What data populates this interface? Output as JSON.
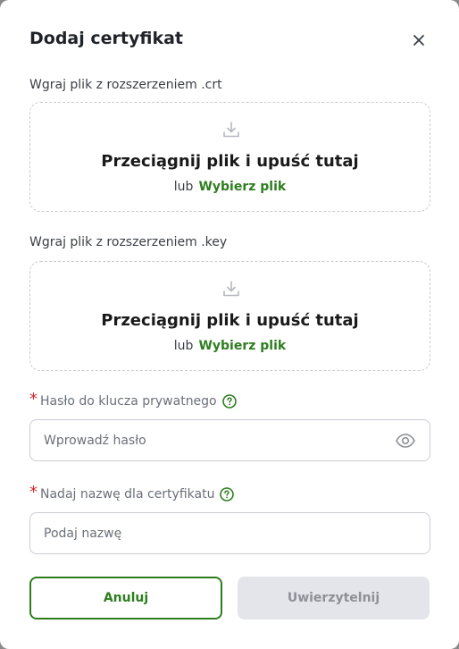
{
  "dialog": {
    "title": "Dodaj certyfikat"
  },
  "crt_upload": {
    "label": "Wgraj plik z rozszerzeniem .crt",
    "drop_text": "Przeciągnij plik i upuść tutaj",
    "or_text": "lub",
    "pick_text": "Wybierz plik"
  },
  "key_upload": {
    "label": "Wgraj plik z rozszerzeniem .key",
    "drop_text": "Przeciągnij plik i upuść tutaj",
    "or_text": "lub",
    "pick_text": "Wybierz plik"
  },
  "password_field": {
    "required_mark": "*",
    "label": "Hasło do klucza prywatnego",
    "placeholder": "Wprowadź hasło",
    "value": ""
  },
  "name_field": {
    "required_mark": "*",
    "label": "Nadaj nazwę dla certyfikatu",
    "placeholder": "Podaj nazwę",
    "value": ""
  },
  "buttons": {
    "cancel": "Anuluj",
    "authenticate": "Uwierzytelnij"
  },
  "colors": {
    "accent": "#2e7d1f",
    "required": "#d42a2a",
    "disabled_bg": "#e4e5ea"
  },
  "icons": {
    "close": "close-icon",
    "upload": "download-tray-icon",
    "help": "question-circle-icon",
    "eye": "eye-icon"
  }
}
